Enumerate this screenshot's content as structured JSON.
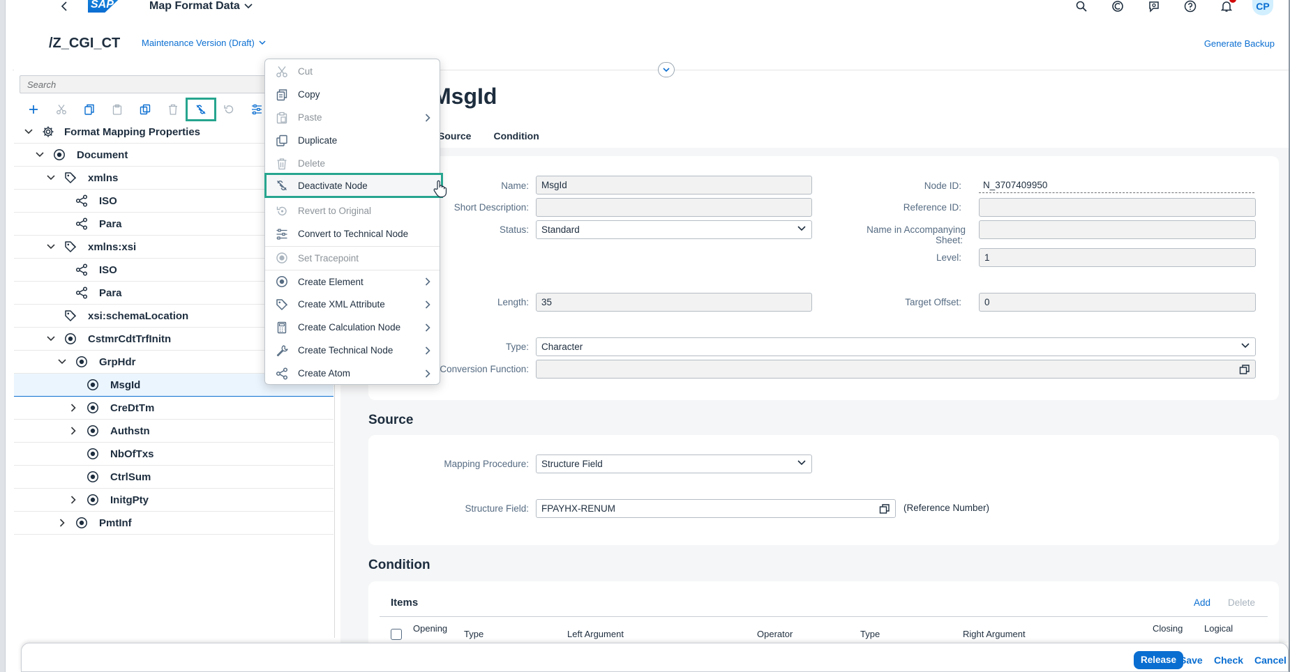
{
  "header": {
    "logo_text": "SAP",
    "app_title": "Map Format Data",
    "avatar_initials": "CP",
    "object_title": "/Z_CGI_CT",
    "version_label": "Maintenance Version (Draft)",
    "generate_backup": "Generate Backup"
  },
  "left": {
    "search_placeholder": "Search",
    "tree": [
      {
        "label": "Format Mapping Properties",
        "icon": "gear-icon",
        "toggle": "expanded"
      },
      {
        "label": "Document",
        "icon": "element-icon",
        "toggle": "expanded"
      },
      {
        "label": "xmlns",
        "icon": "tag-icon",
        "toggle": "expanded"
      },
      {
        "label": "ISO",
        "icon": "atom-icon",
        "toggle": "none"
      },
      {
        "label": "Para",
        "icon": "atom-icon",
        "toggle": "none"
      },
      {
        "label": "xmlns:xsi",
        "icon": "tag-icon",
        "toggle": "expanded"
      },
      {
        "label": "ISO",
        "icon": "atom-icon",
        "toggle": "none"
      },
      {
        "label": "Para",
        "icon": "atom-icon",
        "toggle": "none"
      },
      {
        "label": "xsi:schemaLocation",
        "icon": "tag-icon",
        "toggle": "none"
      },
      {
        "label": "CstmrCdtTrfInitn",
        "icon": "element-icon",
        "toggle": "expanded"
      },
      {
        "label": "GrpHdr",
        "icon": "element-icon",
        "toggle": "expanded"
      },
      {
        "label": "MsgId",
        "icon": "element-icon",
        "toggle": "none",
        "selected": true
      },
      {
        "label": "CreDtTm",
        "icon": "element-icon",
        "toggle": "collapsed"
      },
      {
        "label": "Authstn",
        "icon": "element-icon",
        "toggle": "collapsed"
      },
      {
        "label": "NbOfTxs",
        "icon": "element-icon",
        "toggle": "none"
      },
      {
        "label": "CtrlSum",
        "icon": "element-icon",
        "toggle": "none"
      },
      {
        "label": "InitgPty",
        "icon": "element-icon",
        "toggle": "collapsed"
      },
      {
        "label": "PmtInf",
        "icon": "element-icon",
        "toggle": "collapsed"
      }
    ]
  },
  "context_menu": [
    {
      "label": "Cut",
      "icon": "scissors-icon",
      "disabled": true
    },
    {
      "label": "Copy",
      "icon": "copy-icon",
      "disabled": false
    },
    {
      "label": "Paste",
      "icon": "paste-icon",
      "disabled": true,
      "submenu": true
    },
    {
      "label": "Duplicate",
      "icon": "duplicate-icon",
      "disabled": false
    },
    {
      "label": "Delete",
      "icon": "trash-icon",
      "disabled": true
    },
    {
      "label": "Deactivate Node",
      "icon": "deactivate-icon",
      "disabled": false,
      "highlighted": true
    },
    {
      "label": "Revert to Original",
      "icon": "revert-icon",
      "disabled": true
    },
    {
      "label": "Convert to Technical Node",
      "icon": "convert-icon",
      "disabled": false
    },
    {
      "label": "Set Tracepoint",
      "icon": "tracepoint-icon",
      "disabled": true
    },
    {
      "label": "Create Element",
      "icon": "element-icon",
      "disabled": false,
      "submenu": true
    },
    {
      "label": "Create XML Attribute",
      "icon": "tag-icon",
      "disabled": false,
      "submenu": true
    },
    {
      "label": "Create Calculation Node",
      "icon": "calculator-icon",
      "disabled": false,
      "submenu": true
    },
    {
      "label": "Create Technical Node",
      "icon": "wrench-icon",
      "disabled": false,
      "submenu": true
    },
    {
      "label": "Create Atom",
      "icon": "atom-icon",
      "disabled": false,
      "submenu": true
    }
  ],
  "details": {
    "node_title": "MsgId",
    "tabs": [
      "Source",
      "Condition"
    ],
    "fields": {
      "name": {
        "label": "Name:",
        "value": "MsgId"
      },
      "short_desc": {
        "label": "Short Description:",
        "value": ""
      },
      "status": {
        "label": "Status:",
        "value": "Standard"
      },
      "node_id": {
        "label": "Node ID:",
        "value": "N_3707409950"
      },
      "reference_id": {
        "label": "Reference ID:",
        "value": ""
      },
      "name_accompanying_l1": "Name in Accompanying",
      "name_accompanying_l2": "Sheet:",
      "level": {
        "label": "Level:",
        "value": "1"
      },
      "length": {
        "label": "Length:",
        "value": "35"
      },
      "target_offset": {
        "label": "Target Offset:",
        "value": "0"
      },
      "type": {
        "label": "Type:",
        "value": "Character"
      },
      "conversion_function": {
        "label": "Conversion Function:",
        "value": ""
      }
    },
    "source": {
      "title": "Source",
      "mapping_procedure": {
        "label": "Mapping Procedure:",
        "value": "Structure Field"
      },
      "structure_field": {
        "label": "Structure Field:",
        "value": "FPAYHX-RENUM",
        "description": "(Reference Number)"
      }
    },
    "condition": {
      "title": "Condition",
      "items_title": "Items",
      "add": "Add",
      "delete": "Delete",
      "columns": [
        "Opening",
        "Type",
        "Left Argument",
        "Operator",
        "Type",
        "Right Argument",
        "Closing",
        "Logical"
      ]
    }
  },
  "footer": {
    "release": "Release",
    "save": "Save",
    "check": "Check",
    "cancel": "Cancel"
  }
}
